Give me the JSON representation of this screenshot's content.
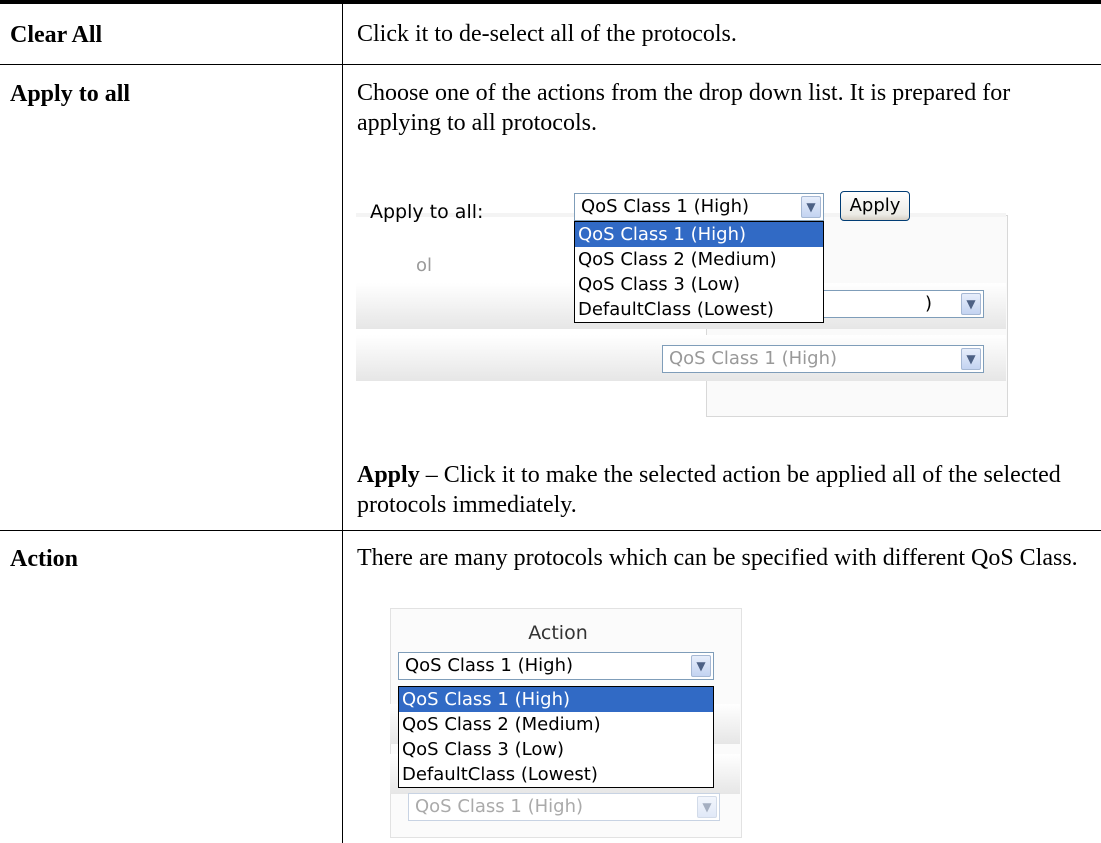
{
  "rows": [
    {
      "term": "Clear All",
      "description": "Click it to de-select all of the protocols."
    },
    {
      "term": "Apply to all",
      "description": "Choose one of the actions from the drop down list. It is prepared for applying to all protocols.",
      "snapshot": {
        "label": "Apply to all:",
        "selected": "QoS Class 1 (High)",
        "button": "Apply",
        "options": [
          "QoS Class 1 (High)",
          "QoS Class 2 (Medium)",
          "QoS Class 3 (Low)",
          "DefaultClass (Lowest)"
        ],
        "partial_label": "ol",
        "partial_row1": ")",
        "partial_row2": "QoS Class 1 (High)"
      },
      "note_bold": "Apply",
      "note_text": " – Click it to make the selected action be applied all of the selected protocols immediately."
    },
    {
      "term": "Action",
      "description": "There are many protocols which can be specified with different QoS Class.",
      "snapshot": {
        "header": "Action",
        "selected": "QoS Class 1 (High)",
        "options": [
          "QoS Class 1 (High)",
          "QoS Class 2 (Medium)",
          "QoS Class 3 (Low)",
          "DefaultClass (Lowest)"
        ],
        "partial_row": "QoS Class 1 (High)"
      }
    }
  ],
  "icons": {
    "dropdown_arrow": "chevron-down-icon"
  },
  "colors": {
    "highlight": "#316ac5",
    "select_border": "#7f9db9"
  }
}
